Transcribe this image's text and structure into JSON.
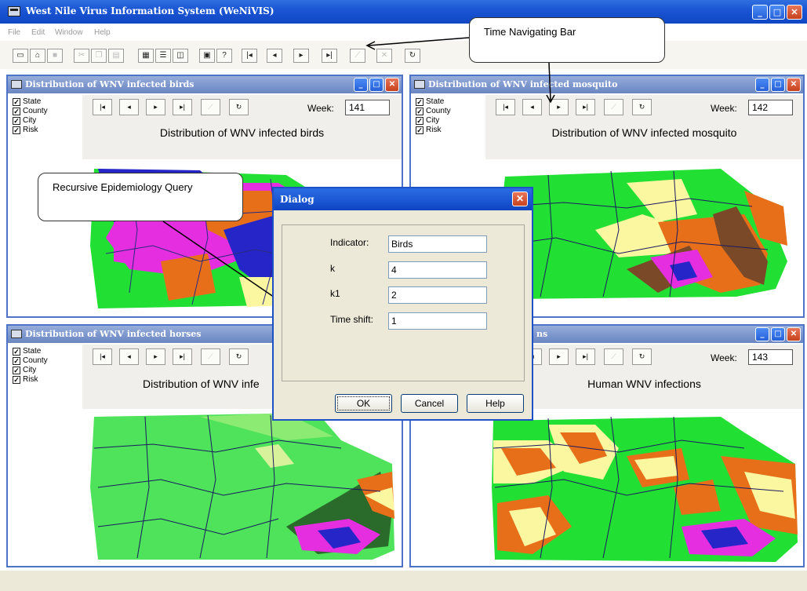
{
  "app": {
    "title": "West Nile Virus Information System (WeNiVIS)",
    "min": "_",
    "max": "□",
    "close": "✕"
  },
  "menu": {
    "file": "File",
    "edit": "Edit",
    "window": "Window",
    "help": "Help"
  },
  "toolbar_icons": [
    "new-file-icon",
    "open-folder-icon",
    "save-icon",
    "cut-icon",
    "copy-icon",
    "paste-icon",
    "cascade-windows-icon",
    "tile-horizontal-icon",
    "tile-vertical-icon",
    "properties-icon",
    "context-help-icon",
    "first-step-icon",
    "step-back-icon",
    "step-forward-icon",
    "last-step-icon",
    "trend-icon",
    "cancel-icon",
    "refresh-icon"
  ],
  "callouts": {
    "time_nav": "Time Navigating Bar",
    "query": "Recursive Epidemiology Query"
  },
  "layers": {
    "state": "State",
    "county": "County",
    "city": "City",
    "risk": "Risk"
  },
  "nav_glyphs": {
    "first": "|◂",
    "back": "◂",
    "forward": "▸",
    "last": "▸|",
    "trend": "⟋",
    "refresh": "↻"
  },
  "windows": {
    "birds": {
      "title": "Distribution of WNV infected birds",
      "week_label": "Week:",
      "week": "141",
      "map_title": "Distribution of WNV infected birds"
    },
    "mosquito": {
      "title": "Distribution of WNV infected mosquito",
      "week_label": "Week:",
      "week": "142",
      "map_title": "Distribution of WNV infected mosquito"
    },
    "horses": {
      "title": "Distribution of WNV infected horses",
      "map_title": "Distribution of WNV infe"
    },
    "human": {
      "title": "ns",
      "week_label": "Week:",
      "week": "143",
      "map_title": "Human WNV infections"
    }
  },
  "dialog": {
    "title": "Dialog",
    "close": "✕",
    "fields": {
      "indicator": {
        "label": "Indicator:",
        "value": "Birds"
      },
      "k": {
        "label": "k",
        "value": "4"
      },
      "k1": {
        "label": "k1",
        "value": "2"
      },
      "time_shift": {
        "label": "Time shift:",
        "value": "1"
      }
    },
    "buttons": {
      "ok": "OK",
      "cancel": "Cancel",
      "help": "Help"
    }
  },
  "colors": {
    "map_green": "#22e033",
    "map_orange": "#e86f1a",
    "map_yellow": "#fbf6a0",
    "map_magenta": "#e42ee0",
    "map_blue": "#2626c8",
    "titlebar_blue": "#1c56d4",
    "inactive_title": "#7a94cc"
  }
}
